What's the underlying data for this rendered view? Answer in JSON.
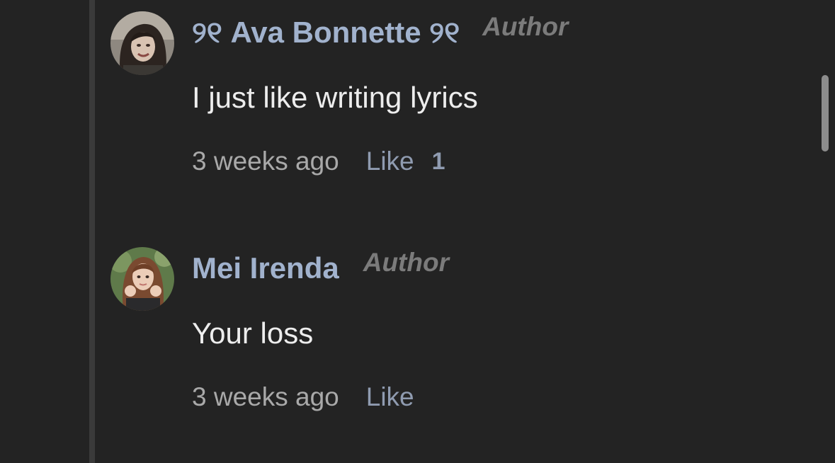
{
  "comments": [
    {
      "username": "୨୧ Ava Bonnette ୨୧",
      "badge": "Author",
      "text": "I just like writing lyrics",
      "time": "3 weeks ago",
      "like_label": "Like",
      "like_count": "1"
    },
    {
      "username": "Mei Irenda",
      "badge": "Author",
      "text": "Your loss",
      "time": "3 weeks ago",
      "like_label": "Like"
    }
  ],
  "colors": {
    "background": "#232323",
    "username": "#a1b2cd",
    "badge": "#7b7b7b",
    "body_text": "#ededed",
    "timestamp": "#a9a9a9",
    "like": "#8f9bb0"
  }
}
